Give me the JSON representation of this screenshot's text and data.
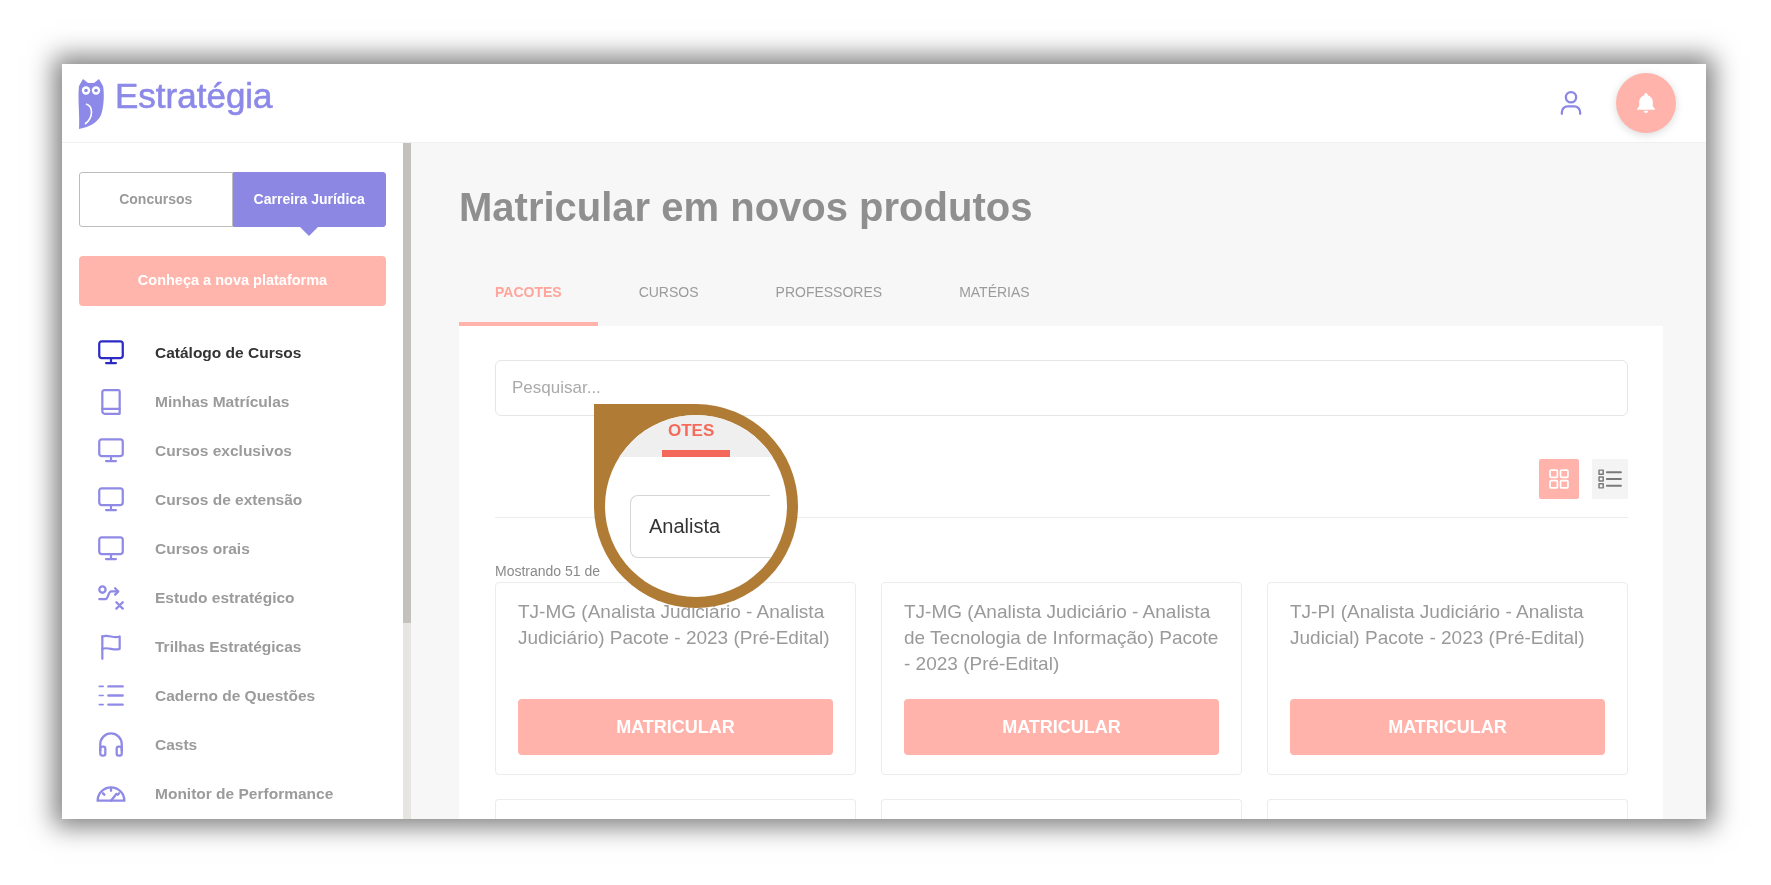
{
  "header": {
    "logo": "Estratégia"
  },
  "sidebar": {
    "toggle": [
      {
        "label": "Concursos",
        "selected": false
      },
      {
        "label": "Carreira Jurídica",
        "selected": true
      }
    ],
    "promo_button": "Conheça a nova plataforma",
    "items": [
      {
        "label": "Catálogo de Cursos",
        "kind": "monitor",
        "selected": true
      },
      {
        "label": "Minhas Matrículas",
        "kind": "book",
        "selected": false
      },
      {
        "label": "Cursos exclusivos",
        "kind": "monitor",
        "selected": false
      },
      {
        "label": "Cursos de extensão",
        "kind": "monitor",
        "selected": false
      },
      {
        "label": "Cursos orais",
        "kind": "monitor",
        "selected": false
      },
      {
        "label": "Estudo estratégico",
        "kind": "route",
        "selected": false
      },
      {
        "label": "Trilhas Estratégicas",
        "kind": "flag",
        "selected": false
      },
      {
        "label": "Caderno de Questões",
        "kind": "numbers",
        "selected": false
      },
      {
        "label": "Casts",
        "kind": "headphones",
        "selected": false
      },
      {
        "label": "Monitor de Performance",
        "kind": "gauge",
        "selected": false
      }
    ]
  },
  "main": {
    "title": "Matricular em novos produtos",
    "tabs": [
      {
        "label": "PACOTES",
        "selected": true
      },
      {
        "label": "CURSOS",
        "selected": false
      },
      {
        "label": "PROFESSORES",
        "selected": false
      },
      {
        "label": "MATÉRIAS",
        "selected": false
      }
    ],
    "search": {
      "placeholder": "Pesquisar..."
    },
    "view_modes": [
      {
        "kind": "grid",
        "selected": true
      },
      {
        "kind": "list",
        "selected": false
      }
    ],
    "result_count": "Mostrando 51 de",
    "cards": [
      {
        "title": "TJ-MG (Analista Judiciário - Analista Judiciário) Pacote - 2023 (Pré-Edital)",
        "button": "MATRICULAR"
      },
      {
        "title": "TJ-MG (Analista Judiciário - Analista de Tecnologia de Informação) Pacote - 2023 (Pré-Edital)",
        "button": "MATRICULAR"
      },
      {
        "title": "TJ-PI (Analista Judiciário - Analista Judicial) Pacote - 2023 (Pré-Edital)",
        "button": "MATRICULAR"
      }
    ]
  },
  "magnifier": {
    "tab": {
      "label": "OTES",
      "selected": true
    },
    "field": {
      "value": "Analista"
    }
  }
}
